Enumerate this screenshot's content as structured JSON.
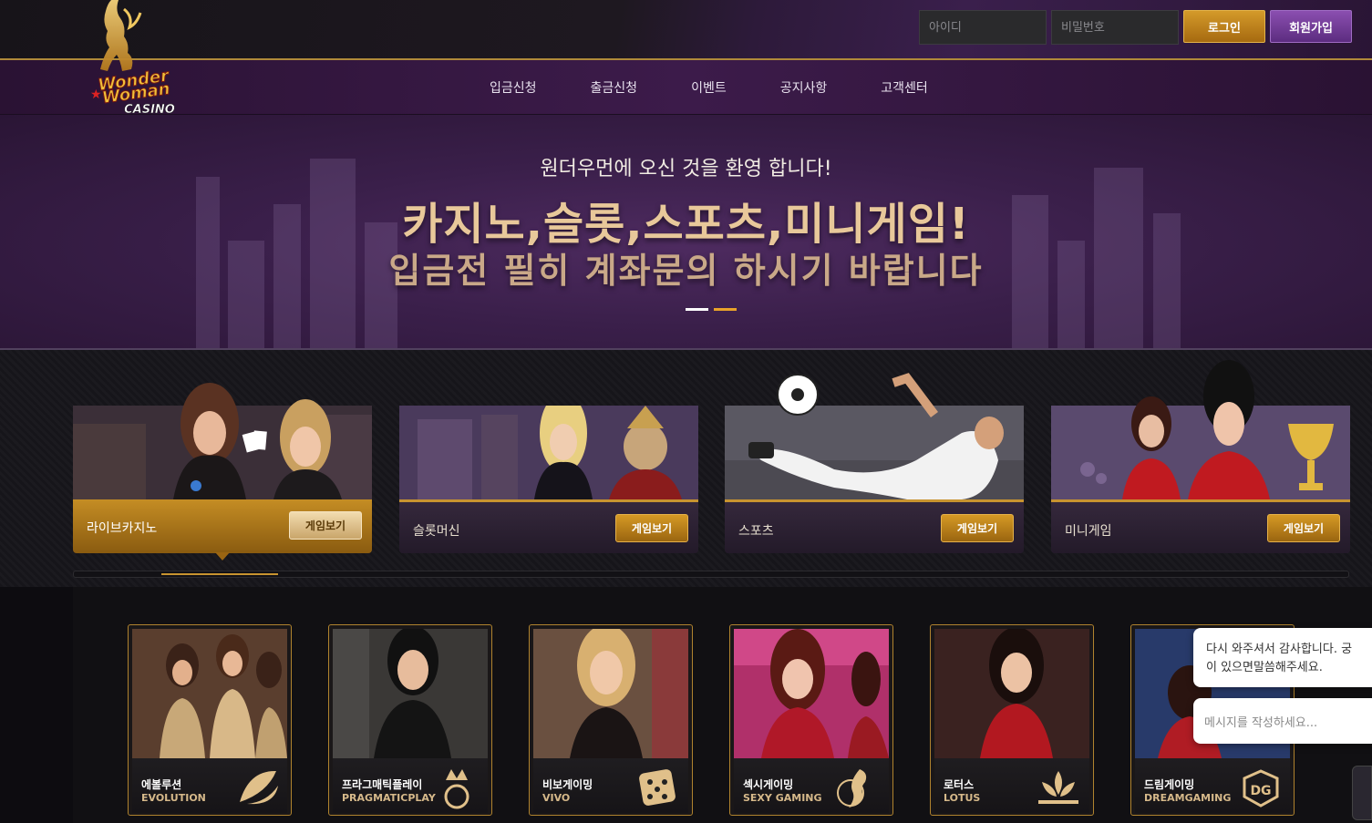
{
  "header": {
    "logo_top": "Wonder",
    "logo_mid": "Woman",
    "logo_bottom": "CASINO",
    "id_placeholder": "아이디",
    "pw_placeholder": "비밀번호",
    "login_label": "로그인",
    "join_label": "회원가입"
  },
  "nav": {
    "items": [
      "입금신청",
      "출금신청",
      "이벤트",
      "공지사항",
      "고객센터"
    ]
  },
  "hero": {
    "subtitle": "원더우먼에 오신 것을 환영 합니다!",
    "title": "카지노,슬롯,스포츠,미니게임!",
    "title2": "입금전 필히 계좌문의 하시기 바랍니다",
    "active_slide": 2,
    "slide_count": 2
  },
  "categories": [
    {
      "label": "라이브카지노",
      "button": "게임보기",
      "active": true
    },
    {
      "label": "슬롯머신",
      "button": "게임보기",
      "active": false
    },
    {
      "label": "스포츠",
      "button": "게임보기",
      "active": false
    },
    {
      "label": "미니게임",
      "button": "게임보기",
      "active": false
    }
  ],
  "providers": [
    {
      "ko": "에볼루션",
      "en": "EVOLUTION",
      "logo": "evolution-icon"
    },
    {
      "ko": "프라그매틱플레이",
      "en": "PRAGMATICPLAY",
      "logo": "pragmatic-crown-icon"
    },
    {
      "ko": "비보게이밍",
      "en": "VIVO",
      "logo": "dice-icon"
    },
    {
      "ko": "섹시게이밍",
      "en": "SEXY GAMING",
      "logo": "sexy-gaming-icon"
    },
    {
      "ko": "로터스",
      "en": "LOTUS",
      "logo": "lotus-icon"
    },
    {
      "ko": "드림게이밍",
      "en": "DREAMGAMING",
      "logo": "dragon-icon"
    }
  ],
  "chat": {
    "greeting_line1": "다시 와주셔서 감사합니다. 궁",
    "greeting_line2": "이 있으면말씀해주세요.",
    "input_placeholder": "메시지를 작성하세요..."
  },
  "colors": {
    "accent_gold": "#c89430",
    "accent_purple": "#5c2c80",
    "hero_purple": "#3a1f4a"
  }
}
